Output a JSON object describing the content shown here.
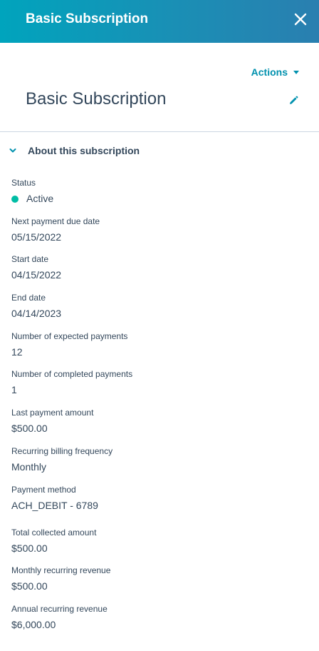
{
  "header": {
    "title": "Basic Subscription"
  },
  "toolbar": {
    "actions_label": "Actions"
  },
  "record": {
    "title": "Basic Subscription"
  },
  "section": {
    "title": "About this subscription",
    "expanded": true
  },
  "properties": [
    {
      "label": "Status",
      "value": "Active",
      "status_color": "#00bda5"
    },
    {
      "label": "Next payment due date",
      "value": "05/15/2022"
    },
    {
      "label": "Start date",
      "value": "04/15/2022"
    },
    {
      "label": "End date",
      "value": "04/14/2023"
    },
    {
      "label": "Number of expected payments",
      "value": "12"
    },
    {
      "label": "Number of completed payments",
      "value": "1"
    },
    {
      "label": "Last payment amount",
      "value": "$500.00"
    },
    {
      "label": "Recurring billing frequency",
      "value": "Monthly"
    },
    {
      "label": "Payment method",
      "value": "ACH_DEBIT - 6789"
    },
    {
      "label": "Total collected amount",
      "value": "$500.00"
    },
    {
      "label": "Monthly recurring revenue",
      "value": "$500.00"
    },
    {
      "label": "Annual recurring revenue",
      "value": "$6,000.00"
    }
  ],
  "colors": {
    "accent": "#0091ae",
    "header_gradient_start": "#00a4bd",
    "header_gradient_end": "#2a7fb0",
    "text": "#33475b",
    "divider": "#cbd6e2"
  },
  "icons": {
    "close": "close-icon",
    "edit": "pencil-icon",
    "collapse": "chevron-down-icon",
    "dropdown": "caret-down-icon"
  }
}
